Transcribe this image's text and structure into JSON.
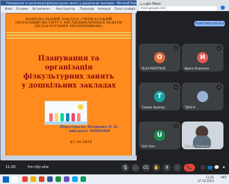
{
  "browser": {
    "tab_title": "Google Meet",
    "url": "meet.google.com/"
  },
  "meet": {
    "top_pill": "Розмістити для всіх",
    "top_label": "",
    "tiles": [
      {
        "initial": "O",
        "name": "OLHA MARTYNUK",
        "color": "#e06b3c"
      },
      {
        "initial": "И",
        "name": "Ирина Якименко",
        "color": "#e35a54"
      },
      {
        "initial": "T",
        "name": "Тамара Кравчук",
        "color": "#1aa3a3"
      },
      {
        "initial": "",
        "name": "ТДН3 Н",
        "color": "#7ab"
      },
      {
        "initial": "U",
        "name": "User User",
        "color": "#1b8a52"
      },
      {
        "initial": "",
        "name": "Оксана Петренко",
        "color": "#ccc"
      }
    ],
    "controls": {
      "time": "11:20",
      "code": "fnn-hfjc-ehe",
      "mic": "🎙",
      "cam": "🎥",
      "cc": "CC",
      "raise": "✋",
      "present": "⬆",
      "more": "⋮",
      "end": "📞",
      "info": "ⓘ",
      "people": "👥",
      "chat": "💬",
      "activities": "✦"
    }
  },
  "powerpoint": {
    "window_title": "Планування та організація фізкультурних занять у дошкільних закладах - Microsoft PowerPoint",
    "ribbon": [
      "Файл",
      "Основне",
      "Вставлення",
      "Конструктор",
      "Переходи",
      "Анімація",
      "Показ слайдів"
    ],
    "slide": {
      "header": "КОМУНАЛЬНИЙ ЗАКЛАД «ЧЕРКАСЬКИЙ ОБЛАСНИЙ ІНСТИТУТ ПІСЛЯДИПЛОМНОЇ ОСВІТИ ПЕДАГОГІЧНИХ ПРАЦІВНИКІВ»",
      "title": "Планування та організація фізкультурних занять у дошкільних закладах",
      "author": "Підготувала: Петренко О. В., викладач ЧОІПОПП",
      "date": "07.10.2024"
    }
  },
  "taskbar": {
    "clock_time": "11:20",
    "clock_date": "07.10.2024",
    "lang": "УКР"
  }
}
